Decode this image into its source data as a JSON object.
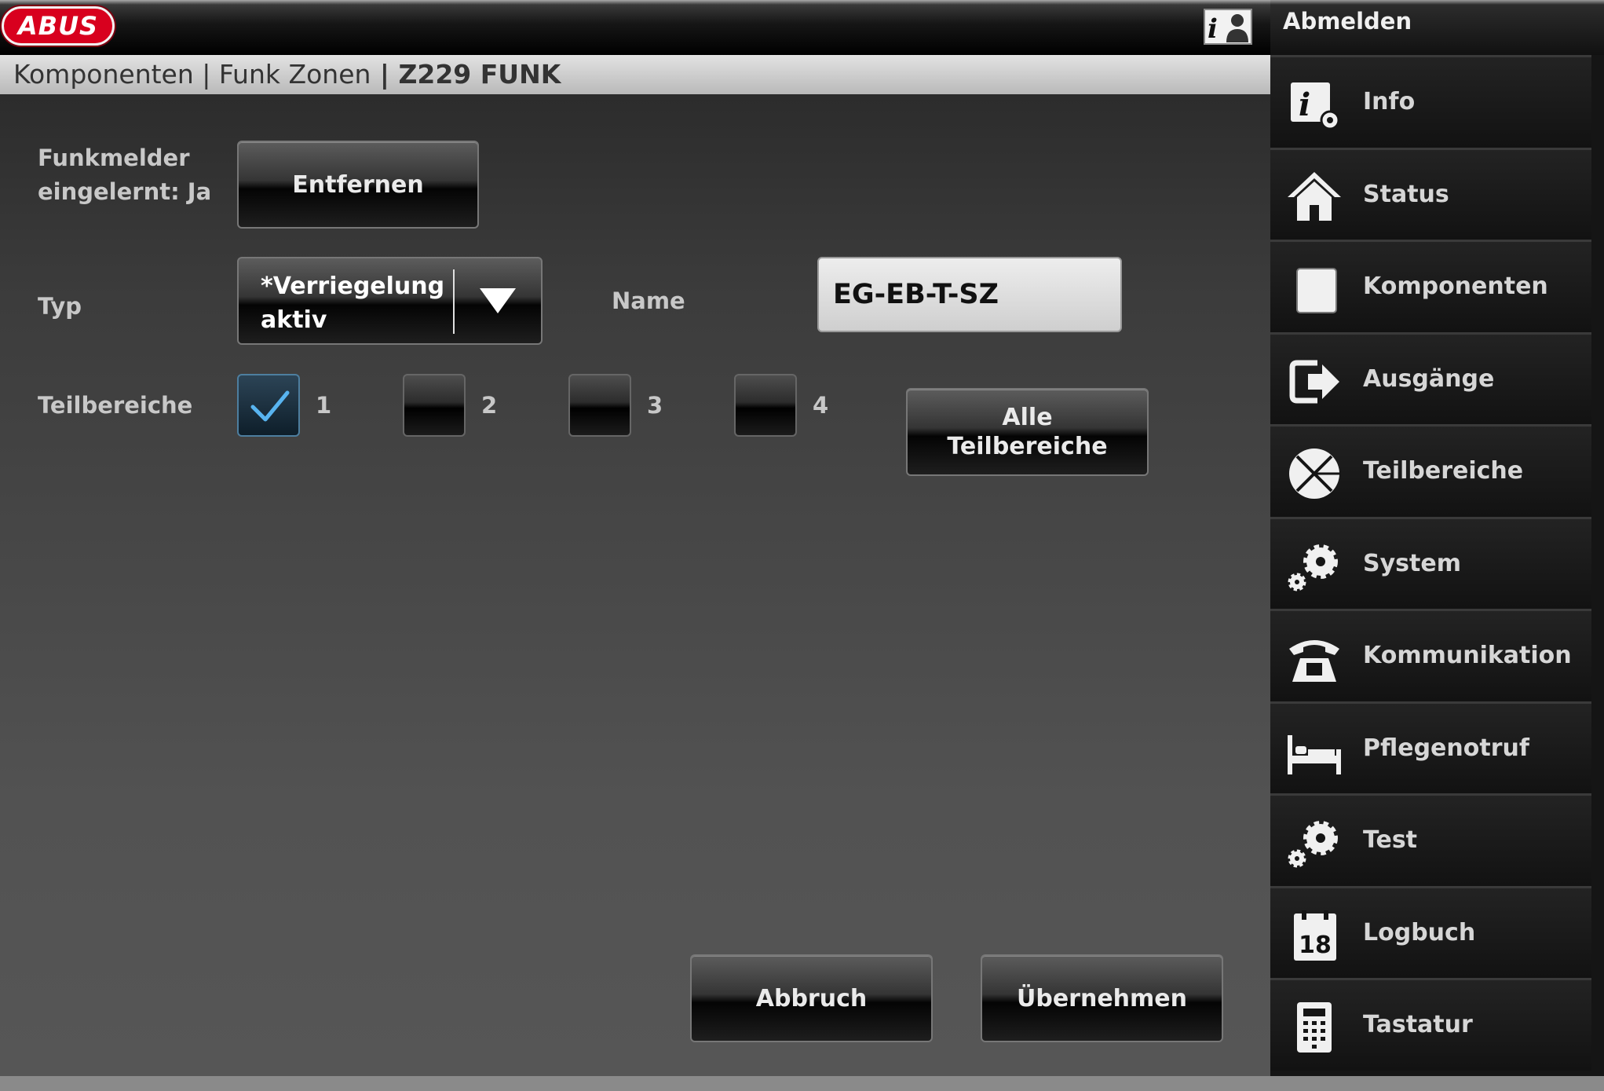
{
  "header": {
    "logo_text": "ABUS",
    "breadcrumb": {
      "part1": "Komponenten",
      "sep1": " | ",
      "part2": "Funk Zonen",
      "current": " | Z229 FUNK"
    }
  },
  "form": {
    "funkmelder_line1": "Funkmelder",
    "funkmelder_line2": "eingelernt: Ja",
    "remove_button": "Entfernen",
    "typ_label": "Typ",
    "typ_value": "*Verriegelung aktiv",
    "name_label": "Name",
    "name_value": "EG-EB-T-SZ",
    "teilbereiche_label": "Teilbereiche",
    "partitions": [
      {
        "num": "1",
        "checked": true
      },
      {
        "num": "2",
        "checked": false
      },
      {
        "num": "3",
        "checked": false
      },
      {
        "num": "4",
        "checked": false
      }
    ],
    "all_partitions_line1": "Alle",
    "all_partitions_line2": "Teilbereiche",
    "cancel_button": "Abbruch",
    "apply_button": "Übernehmen"
  },
  "sidebar": {
    "logout": "Abmelden",
    "items": [
      {
        "label": "Info",
        "icon": "info-gear-icon"
      },
      {
        "label": "Status",
        "icon": "house-icon"
      },
      {
        "label": "Komponenten",
        "icon": "square-icon"
      },
      {
        "label": "Ausgänge",
        "icon": "exit-arrow-icon"
      },
      {
        "label": "Teilbereiche",
        "icon": "partition-pie-icon"
      },
      {
        "label": "System",
        "icon": "gears-icon"
      },
      {
        "label": "Kommunikation",
        "icon": "telephone-icon"
      },
      {
        "label": "Pflegenotruf",
        "icon": "bed-icon"
      },
      {
        "label": "Test",
        "icon": "gears-icon"
      },
      {
        "label": "Logbuch",
        "icon": "calendar-icon"
      },
      {
        "label": "Tastatur",
        "icon": "keypad-icon"
      }
    ],
    "logbuch_day": "18"
  },
  "colors": {
    "brand_red": "#d8001e",
    "check_blue": "#58b4f0"
  }
}
